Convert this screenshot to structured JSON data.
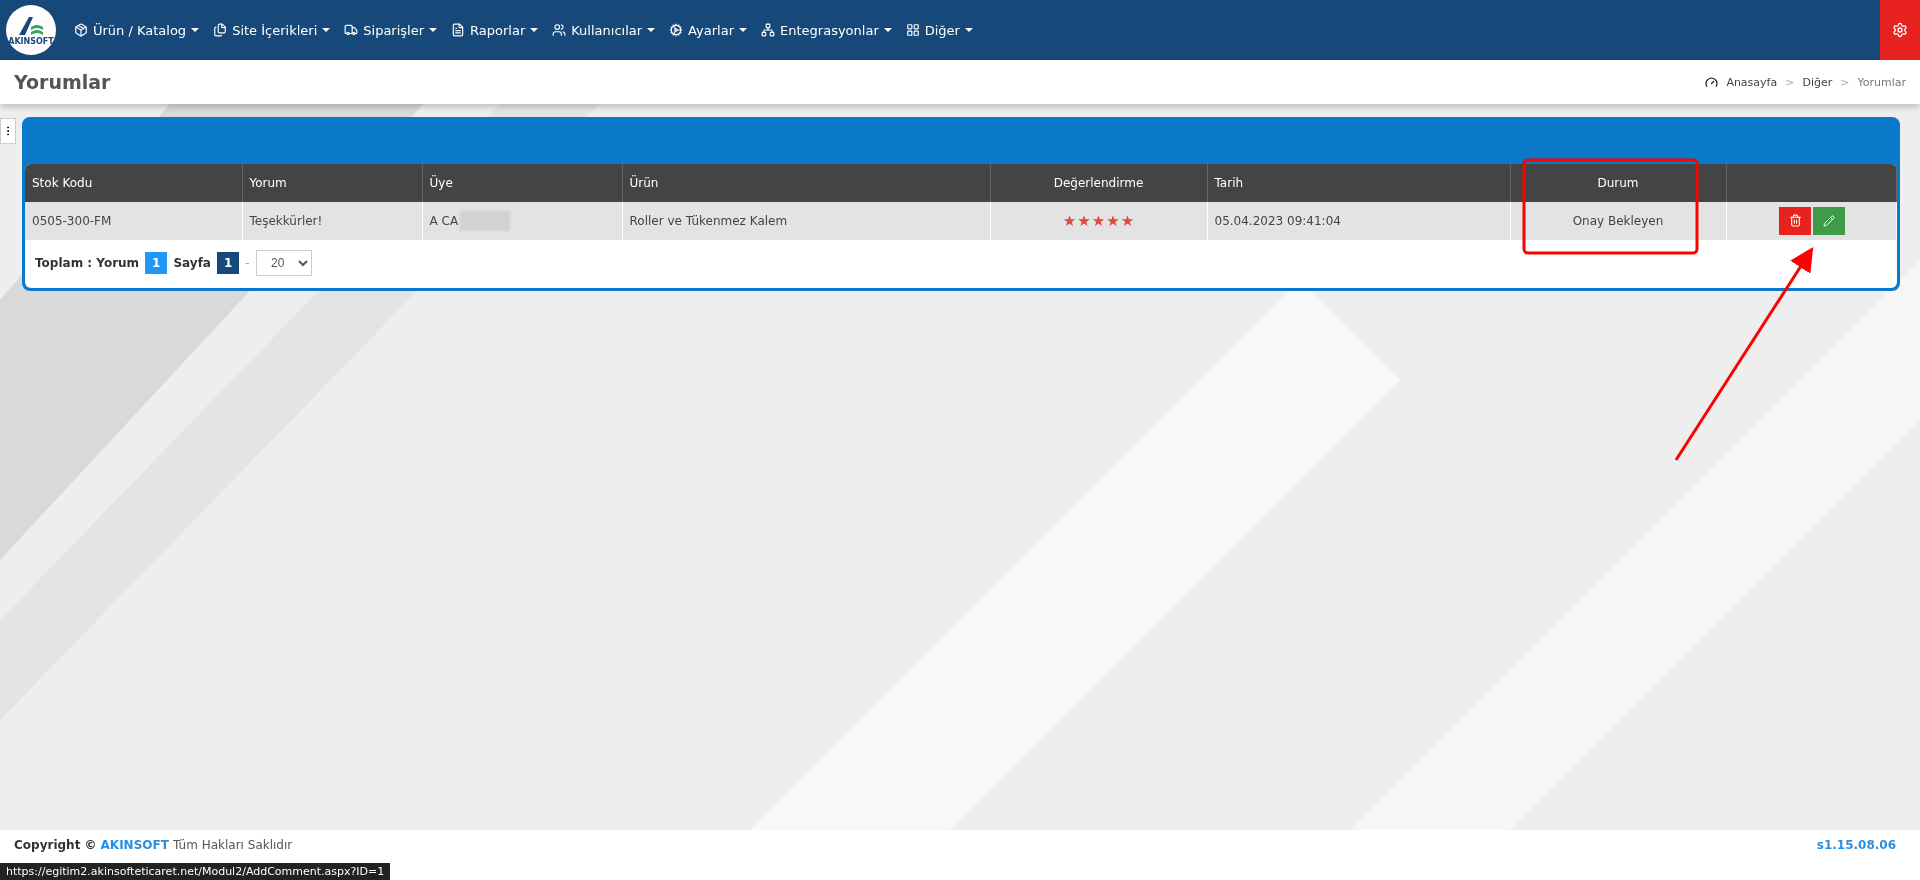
{
  "navbar": {
    "logo_text": "AKINSOFT",
    "menu": [
      {
        "label": "Ürün / Katalog",
        "kind": "package"
      },
      {
        "label": "Site İçerikleri",
        "kind": "files"
      },
      {
        "label": "Siparişler",
        "kind": "truck"
      },
      {
        "label": "Raporlar",
        "kind": "report"
      },
      {
        "label": "Kullanıcılar",
        "kind": "users"
      },
      {
        "label": "Ayarlar",
        "kind": "cogs"
      },
      {
        "label": "Entegrasyonlar",
        "kind": "network"
      },
      {
        "label": "Diğer",
        "kind": "grid"
      }
    ]
  },
  "page_header": {
    "title": "Yorumlar",
    "breadcrumb": [
      {
        "label": "Anasayfa",
        "selected": false
      },
      {
        "label": "Diğer",
        "selected": false
      },
      {
        "label": "Yorumlar",
        "selected": true
      }
    ],
    "separator": ">"
  },
  "table": {
    "columns": [
      "Stok Kodu",
      "Yorum",
      "Üye",
      "Ürün",
      "Değerlendirme",
      "Tarih",
      "Durum"
    ],
    "rows": [
      {
        "stock_code": "0505-300-FM",
        "comment": "Teşekkürler!",
        "member": "A CA",
        "product": "Roller ve Tükenmez Kalem",
        "stars": 5,
        "date": "05.04.2023 09:41:04",
        "status": "Onay Bekleyen"
      }
    ]
  },
  "pagination": {
    "total_label": "Toplam : Yorum",
    "total": "1",
    "page_label": "Sayfa",
    "pages": [
      {
        "label": "1",
        "selected": true
      }
    ],
    "dash": "-",
    "page_size": "20"
  },
  "footer": {
    "copyright": "Copyright ©",
    "brand": "AKINSOFT",
    "rights": "Tüm Hakları Saklıdır",
    "version": "s1.15.08.06"
  },
  "status_url": "https://egitim2.akinsofteticaret.net/Modul2/AddComment.aspx?ID=1"
}
